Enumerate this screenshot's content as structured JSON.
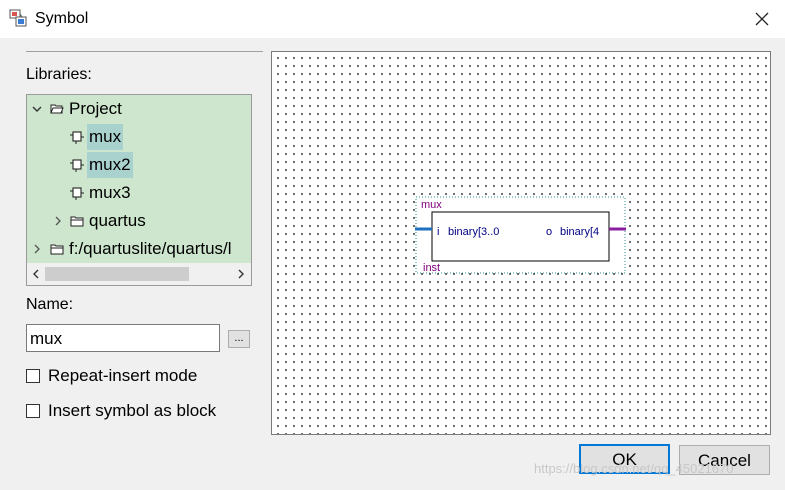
{
  "window": {
    "title": "Symbol",
    "close_glyph": "✕"
  },
  "libraries_label": "Libraries:",
  "tree": {
    "items": [
      {
        "label": "Project",
        "icon": "folder-icon",
        "expanded": true
      },
      {
        "label": "mux",
        "icon": "symbol-icon",
        "selected": true
      },
      {
        "label": "mux2",
        "icon": "symbol-icon",
        "highlighted": true
      },
      {
        "label": "mux3",
        "icon": "symbol-icon"
      },
      {
        "label": "quartus",
        "icon": "folder-icon",
        "expanded": false
      },
      {
        "label": "f:/quartuslite/quartus/l",
        "icon": "folder-icon",
        "expanded": false
      }
    ]
  },
  "name_label": "Name:",
  "name_value": "mux",
  "browse_label": "...",
  "options": {
    "repeat_insert": {
      "label": "Repeat-insert mode",
      "checked": false
    },
    "insert_as_block": {
      "label": "Insert symbol as block",
      "checked": false
    }
  },
  "preview": {
    "symbol_name": "mux",
    "instance_name": "inst",
    "input_port": "i",
    "input_bus": "binary[3..0",
    "output_port": "o",
    "output_bus": "binary[4",
    "input_wire_color": "#1f6fbf",
    "output_wire_color": "#8a1fa0",
    "label_color": "#800080"
  },
  "buttons": {
    "ok": "OK",
    "cancel": "Cancel"
  },
  "watermark": "https://blog.csdn.net/qq_45021670"
}
